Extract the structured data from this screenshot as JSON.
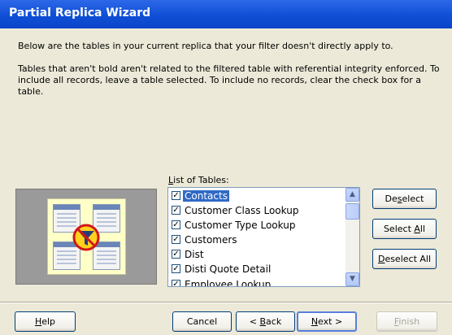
{
  "window": {
    "title": "Partial Replica Wizard"
  },
  "intro": "Below are the tables in your current replica that your filter doesn't directly apply to.",
  "explanation": "Tables that aren't bold aren't related to the filtered table with referential integrity enforced. To include all records, leave a table selected. To include no records, clear the check box for a table.",
  "list": {
    "label_prefix": "L",
    "label_rest": "ist of Tables:",
    "items": [
      {
        "label": "Contacts",
        "checked": true,
        "selected": true
      },
      {
        "label": "Customer Class Lookup",
        "checked": true
      },
      {
        "label": "Customer Type Lookup",
        "checked": true
      },
      {
        "label": "Customers",
        "checked": true
      },
      {
        "label": "Dist",
        "checked": true
      },
      {
        "label": "Disti Quote Detail",
        "checked": true
      },
      {
        "label": "Employee Lookup",
        "checked": true
      }
    ]
  },
  "buttons": {
    "deselect": {
      "a": "De",
      "u": "s",
      "b": "elect"
    },
    "select_all": {
      "a": "Select ",
      "u": "A",
      "b": "ll"
    },
    "deselect_all": {
      "a": "",
      "u": "D",
      "b": "eselect All"
    },
    "help": {
      "a": "",
      "u": "H",
      "b": "elp"
    },
    "cancel": {
      "label": "Cancel"
    },
    "back": {
      "a": "< ",
      "u": "B",
      "b": "ack"
    },
    "next": {
      "a": "",
      "u": "N",
      "b": "ext >"
    },
    "finish": {
      "a": "",
      "u": "F",
      "b": "inish"
    }
  },
  "icons": {
    "check": "✓",
    "up": "▲",
    "down": "▼"
  },
  "colors": {
    "titlebar": "#0f4fd6",
    "selection": "#316ac5",
    "face": "#ece9d8"
  }
}
